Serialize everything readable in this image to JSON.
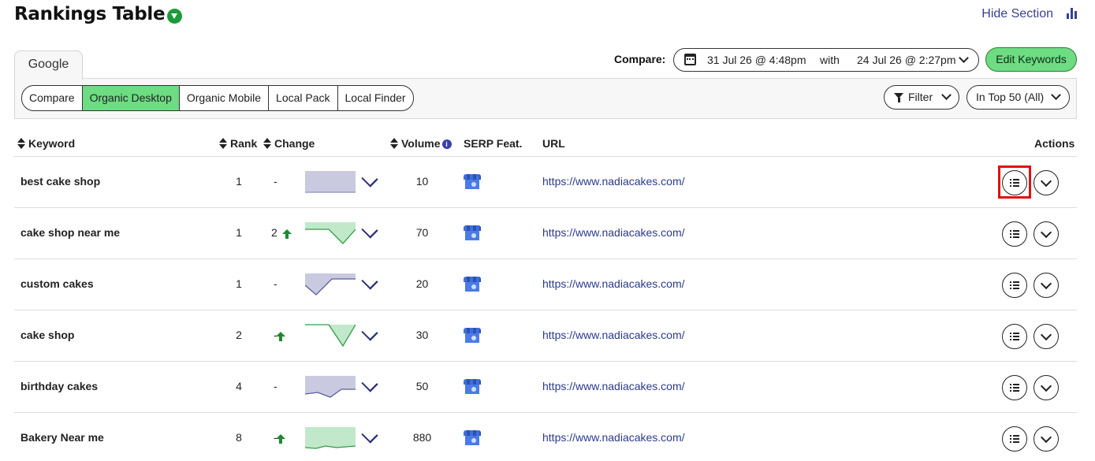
{
  "header": {
    "title": "Rankings Table",
    "hide_label": "Hide Section"
  },
  "engine_tab": "Google",
  "compare": {
    "label": "Compare:",
    "from": "31 Jul 26 @ 4:48pm",
    "with": "with",
    "to": "24 Jul 26 @ 2:27pm"
  },
  "edit_keywords_label": "Edit Keywords",
  "views": [
    "Compare",
    "Organic Desktop",
    "Organic Mobile",
    "Local Pack",
    "Local Finder"
  ],
  "active_view": "Organic Desktop",
  "filter_label": "Filter",
  "top_label": "In Top 50 (All)",
  "columns": {
    "keyword": "Keyword",
    "rank": "Rank",
    "change": "Change",
    "volume": "Volume",
    "volume_info": "i",
    "serp": "SERP Feat.",
    "url": "URL",
    "actions": "Actions"
  },
  "colors": {
    "accent_green": "#6ddc83",
    "trend_up": "#1e8a2e",
    "trend_flat": "#8e90b8",
    "link": "#2b3a8c",
    "highlight": "#e01010"
  },
  "rows": [
    {
      "keyword": "best cake shop",
      "rank": "1",
      "change": "-",
      "change_dir": "none",
      "spark": "flat",
      "volume": "10",
      "serp_icon": "store-icon",
      "url": "https://www.nadiacakes.com/"
    },
    {
      "keyword": "cake shop near me",
      "rank": "1",
      "change": "2",
      "change_dir": "up",
      "spark": "up-v",
      "volume": "70",
      "serp_icon": "store-icon",
      "url": "https://www.nadiacakes.com/"
    },
    {
      "keyword": "custom cakes",
      "rank": "1",
      "change": "-",
      "change_dir": "none",
      "spark": "dip-left",
      "volume": "20",
      "serp_icon": "store-icon",
      "url": "https://www.nadiacakes.com/"
    },
    {
      "keyword": "cake shop",
      "rank": "2",
      "change": "-",
      "change_dir": "up",
      "spark": "up-v-mid",
      "volume": "30",
      "serp_icon": "store-icon",
      "url": "https://www.nadiacakes.com/"
    },
    {
      "keyword": "birthday cakes",
      "rank": "4",
      "change": "-",
      "change_dir": "none",
      "spark": "dip-mid",
      "volume": "50",
      "serp_icon": "store-icon",
      "url": "https://www.nadiacakes.com/"
    },
    {
      "keyword": "Bakery Near me",
      "rank": "8",
      "change": "-",
      "change_dir": "up",
      "spark": "up-flat",
      "volume": "880",
      "serp_icon": "store-icon",
      "url": "https://www.nadiacakes.com/"
    }
  ],
  "highlighted_action": "row-1-details-button"
}
